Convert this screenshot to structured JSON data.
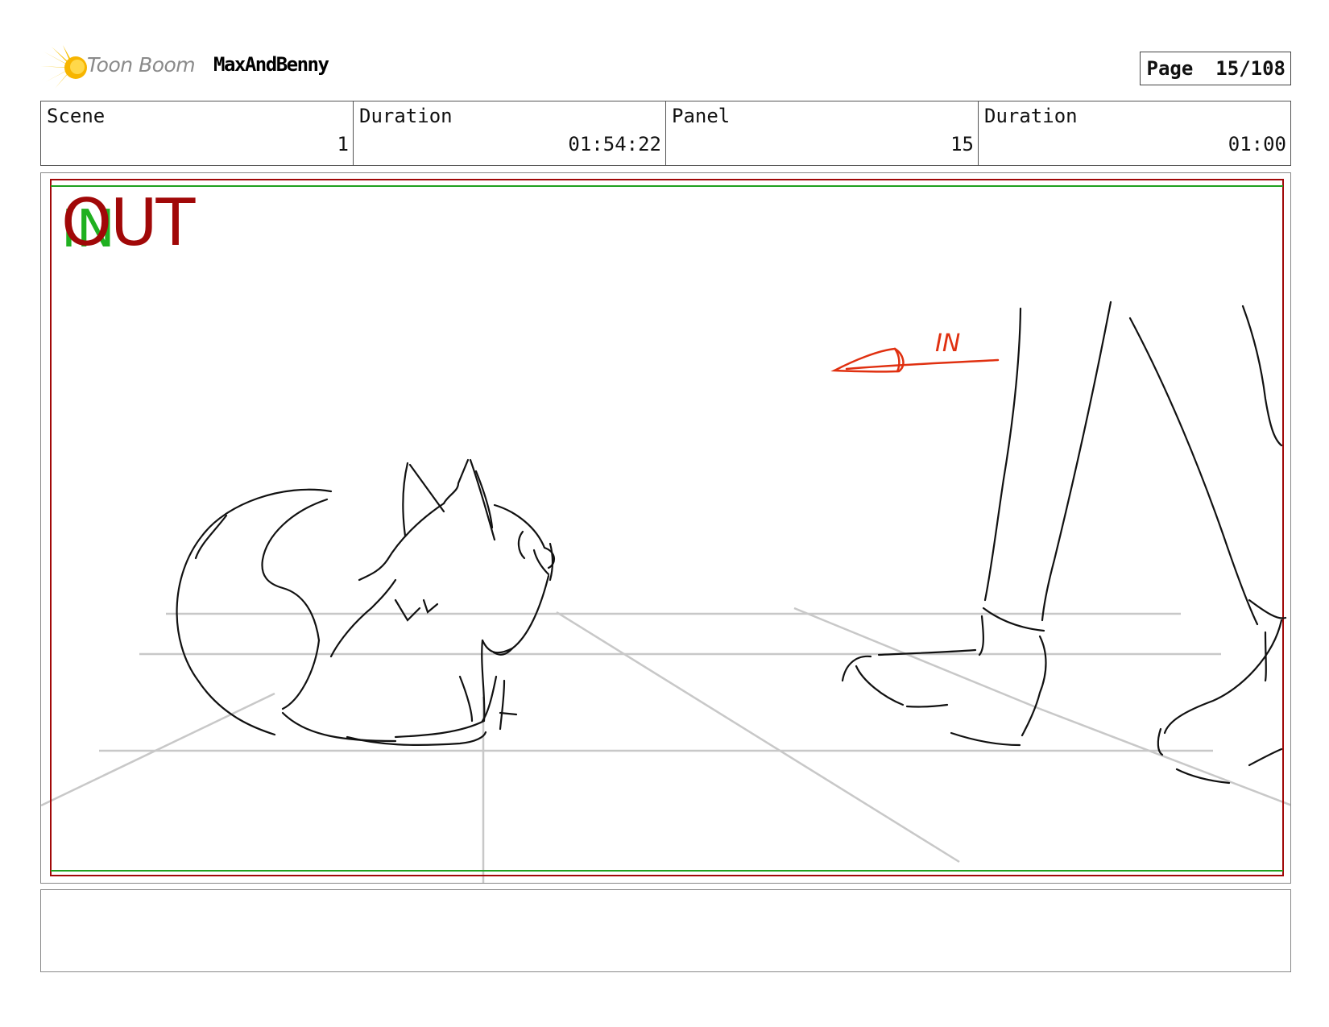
{
  "header": {
    "brand": "Toon Boom",
    "project": "MaxAndBenny",
    "page_label": "Page",
    "page_value": "15/108",
    "logo_icon": "toon-boom-burst-icon"
  },
  "info": {
    "scene_label": "Scene",
    "scene_value": "1",
    "duration_label": "Duration",
    "duration_value": "01:54:22",
    "panel_label": "Panel",
    "panel_value": "15",
    "panel_duration_label": "Duration",
    "panel_duration_value": "01:00"
  },
  "panel": {
    "in_label": "IN",
    "out_label": "OUT",
    "arrow_note": "IN",
    "colors": {
      "safe_frame": "#a10808",
      "title_safe": "#20a020",
      "annotation": "#e03010",
      "guides": "#c8c8c8",
      "sketch": "#111111"
    }
  },
  "notes": {
    "text": ""
  }
}
